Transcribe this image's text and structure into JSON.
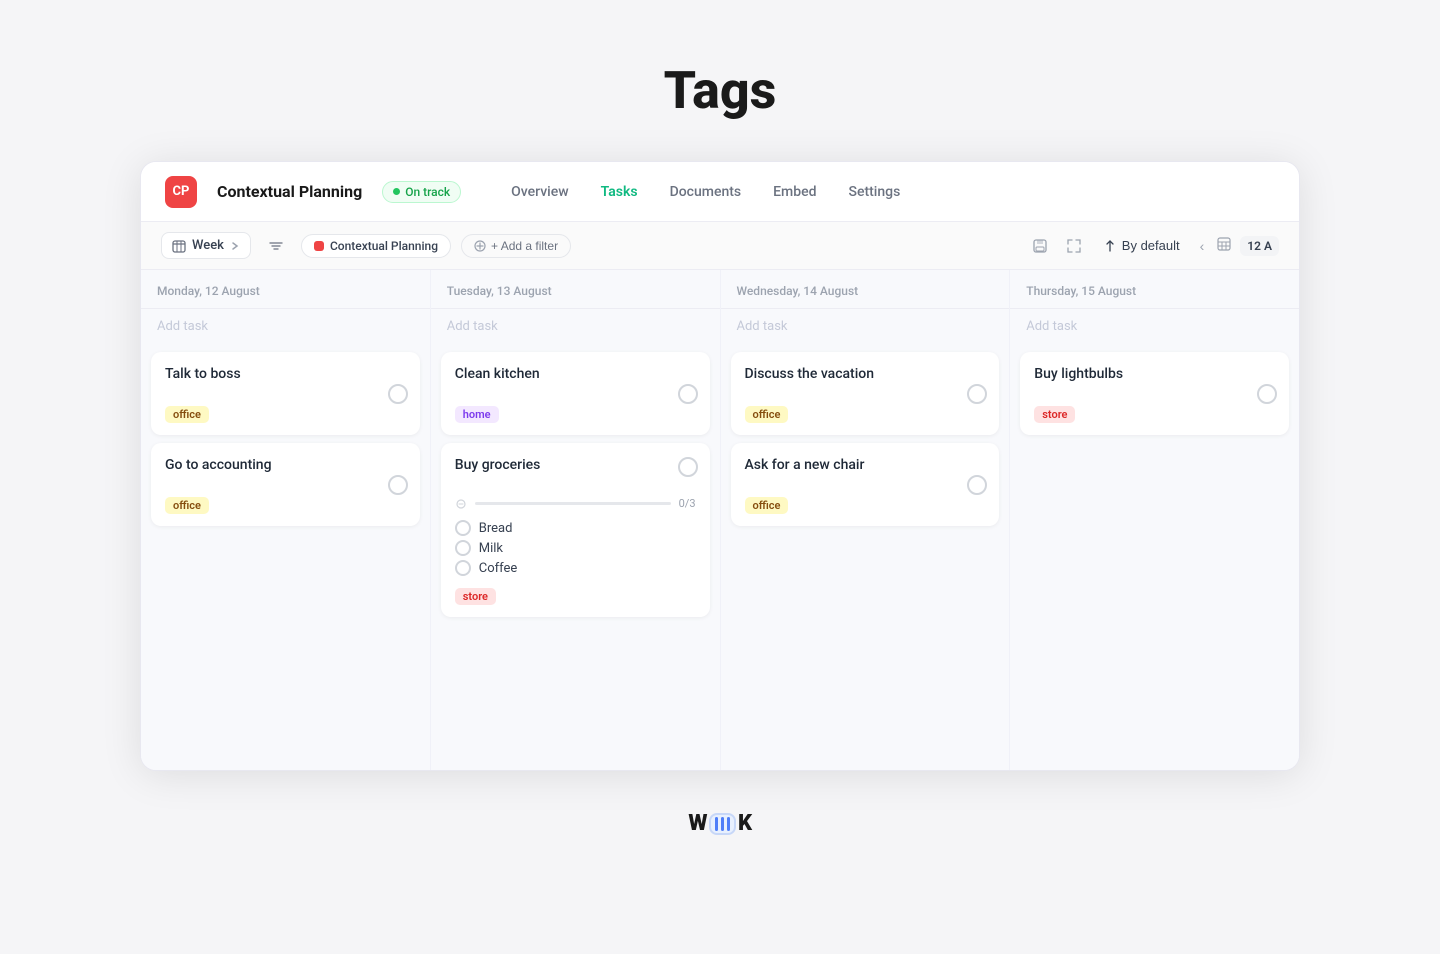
{
  "page": {
    "title": "Tags"
  },
  "header": {
    "logo_initials": "CP",
    "project_name": "Contextual Planning",
    "status_label": "On track",
    "nav_links": [
      {
        "label": "Overview",
        "active": false
      },
      {
        "label": "Tasks",
        "active": true
      },
      {
        "label": "Documents",
        "active": false
      },
      {
        "label": "Embed",
        "active": false
      },
      {
        "label": "Settings",
        "active": false
      }
    ]
  },
  "toolbar": {
    "week_label": "Week",
    "project_chip_label": "Contextual Planning",
    "add_filter_label": "+ Add a filter",
    "sort_label": "By default",
    "date_badge": "12 A"
  },
  "days": [
    {
      "date": "Monday, 12 August",
      "add_task_placeholder": "Add task",
      "tasks": [
        {
          "id": "task-1",
          "title": "Talk to boss",
          "tag": "office",
          "tag_type": "office"
        },
        {
          "id": "task-2",
          "title": "Go to accounting",
          "tag": "office",
          "tag_type": "office"
        }
      ]
    },
    {
      "date": "Tuesday, 13 August",
      "add_task_placeholder": "Add task",
      "tasks": [
        {
          "id": "task-3",
          "title": "Clean kitchen",
          "tag": "home",
          "tag_type": "home"
        },
        {
          "id": "task-4",
          "title": "Buy groceries",
          "tag": "store",
          "tag_type": "store",
          "is_grocery": true,
          "progress": "0/3",
          "subtasks": [
            "Bread",
            "Milk",
            "Coffee"
          ]
        }
      ]
    },
    {
      "date": "Wednesday, 14 August",
      "add_task_placeholder": "Add task",
      "tasks": [
        {
          "id": "task-5",
          "title": "Discuss the vacation",
          "tag": "office",
          "tag_type": "office"
        },
        {
          "id": "task-6",
          "title": "Ask for a new chair",
          "tag": "office",
          "tag_type": "office"
        }
      ]
    },
    {
      "date": "Thursday, 15 August",
      "add_task_placeholder": "Add task",
      "tasks": [
        {
          "id": "task-7",
          "title": "Buy lightbulbs",
          "tag": "store",
          "tag_type": "store"
        }
      ]
    }
  ],
  "footer": {
    "logo_w": "W",
    "logo_k": "K"
  }
}
